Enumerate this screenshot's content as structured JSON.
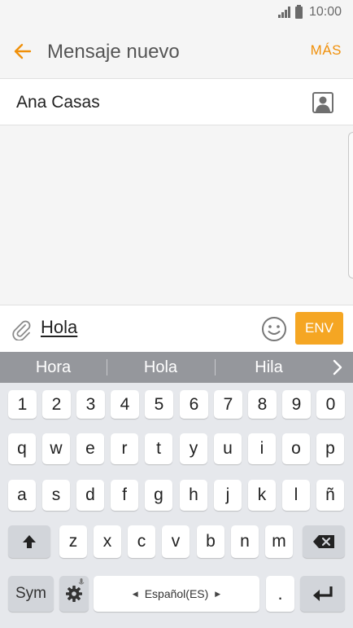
{
  "status_bar": {
    "time": "10:00"
  },
  "header": {
    "title": "Mensaje nuevo",
    "more_label": "MÁS"
  },
  "recipient": {
    "name": "Ana Casas"
  },
  "compose": {
    "text": "Hola",
    "send_label": "ENV"
  },
  "keyboard": {
    "suggestions": [
      "Hora",
      "Hola",
      "Hila"
    ],
    "numbers": [
      "1",
      "2",
      "3",
      "4",
      "5",
      "6",
      "7",
      "8",
      "9",
      "0"
    ],
    "row1": [
      "q",
      "w",
      "e",
      "r",
      "t",
      "y",
      "u",
      "i",
      "o",
      "p"
    ],
    "row2": [
      "a",
      "s",
      "d",
      "f",
      "g",
      "h",
      "j",
      "k",
      "l",
      "ñ"
    ],
    "row3": [
      "z",
      "x",
      "c",
      "v",
      "b",
      "n",
      "m"
    ],
    "sym_label": "Sym",
    "language_label": "Español(ES)",
    "period_label": "."
  },
  "colors": {
    "accent": "#f0900a",
    "send_button": "#f5a623",
    "suggestion_bar": "#95979c"
  }
}
